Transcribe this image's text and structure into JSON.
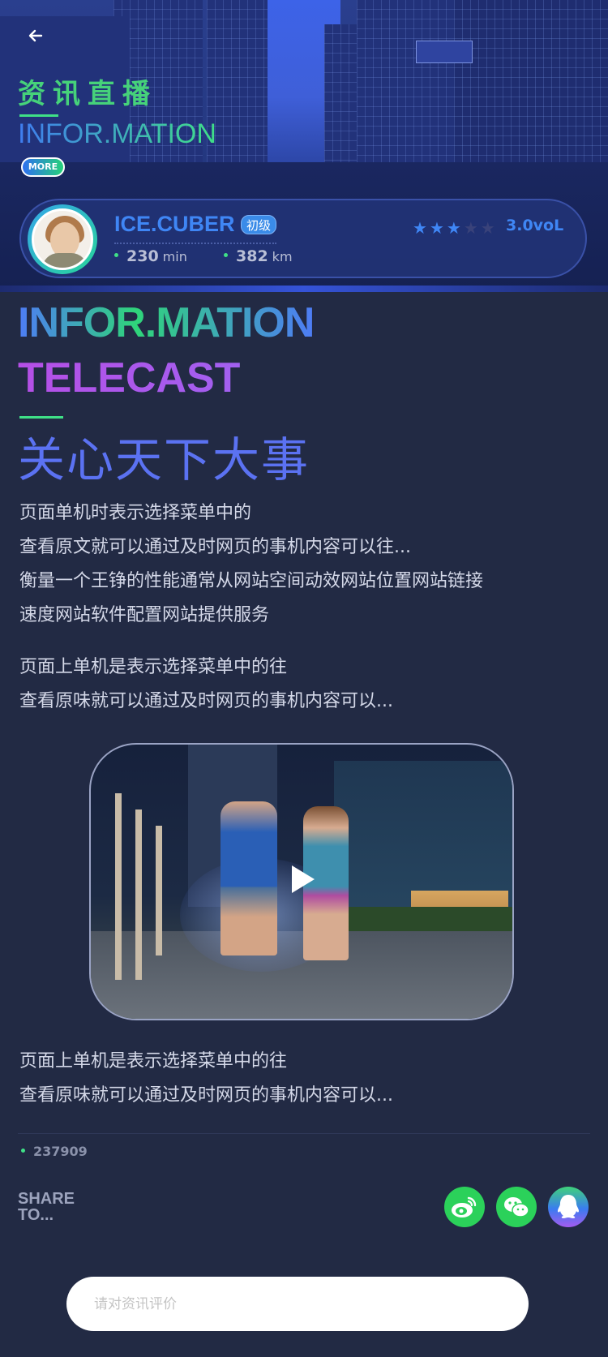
{
  "header": {
    "title_cn": "资讯直播",
    "title_en": "INFOR.MATION",
    "more_label": "MORE"
  },
  "profile": {
    "name": "ICE.CUBER",
    "level": "初级",
    "time_value": "230",
    "time_unit": "min",
    "distance_value": "382",
    "distance_unit": "km",
    "rating": 3,
    "rating_max": 5,
    "volume": "3.0voL"
  },
  "article": {
    "title_en_1": "INFOR.MATION",
    "title_en_2": "TELECAST",
    "title_cn": "关心天下大事",
    "paragraph1": [
      "页面单机时表示选择菜单中的",
      "查看原文就可以通过及时网页的事机内容可以往...",
      "衡量一个王铮的性能通常从网站空间动效网站位置网站链接",
      "速度网站软件配置网站提供服务"
    ],
    "paragraph2": [
      "页面上单机是表示选择菜单中的往",
      "查看原味就可以通过及时网页的事机内容可以..."
    ],
    "paragraph3": [
      "页面上单机是表示选择菜单中的往",
      "查看原味就可以通过及时网页的事机内容可以..."
    ]
  },
  "stats": {
    "views": "237909"
  },
  "share": {
    "label_line1": "SHARE",
    "label_line2": "TO...",
    "targets": [
      {
        "name": "weibo-icon",
        "color": "#2bd15a"
      },
      {
        "name": "wechat-icon",
        "color": "#2bd15a"
      },
      {
        "name": "qq-icon",
        "color": "#3a7cf0"
      }
    ]
  },
  "comment": {
    "placeholder": "请对资讯评价"
  }
}
